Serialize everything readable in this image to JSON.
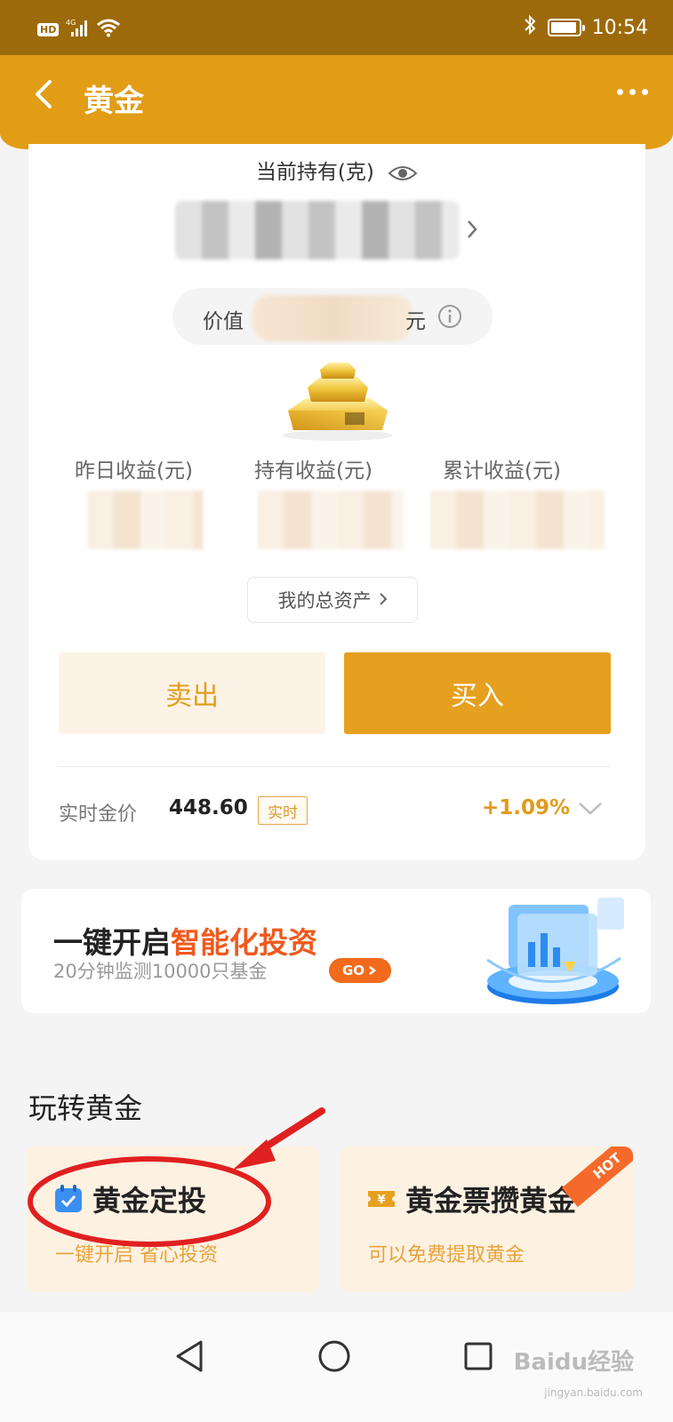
{
  "status_bar": {
    "badge": "HD",
    "network": "4G",
    "time": "10:54"
  },
  "header": {
    "title": "黄金",
    "back_icon": "chevron-left-icon",
    "more_icon": "more-dots-icon"
  },
  "holding": {
    "label": "当前持有(克)",
    "value_label": "价值",
    "value_unit": "元"
  },
  "stats": [
    {
      "label": "昨日收益(元)"
    },
    {
      "label": "持有收益(元)"
    },
    {
      "label": "累计收益(元)"
    }
  ],
  "total_assets_label": "我的总资产",
  "actions": {
    "sell": "卖出",
    "buy": "买入"
  },
  "gold_price": {
    "label": "实时金价",
    "value": "448.60",
    "tag": "实时",
    "change": "+1.09%"
  },
  "banner": {
    "title_prefix": "一键开启",
    "title_accent": "智能化投资",
    "subtitle": "20分钟监测10000只基金",
    "go": "GO"
  },
  "section": {
    "title": "玩转黄金",
    "tiles": [
      {
        "title": "黄金定投",
        "subtitle": "一键开启 省心投资",
        "icon": "calendar-check-icon"
      },
      {
        "title": "黄金票攒黄金",
        "subtitle": "可以免费提取黄金",
        "icon": "ticket-icon",
        "badge": "HOT"
      }
    ]
  },
  "watermark": {
    "text": "Baidu经验",
    "sub": "jingyan.baidu.com"
  },
  "colors": {
    "status_bar": "#9c6a0a",
    "header": "#e19d16",
    "buy": "#e6a020",
    "accent": "#f05a1e"
  }
}
